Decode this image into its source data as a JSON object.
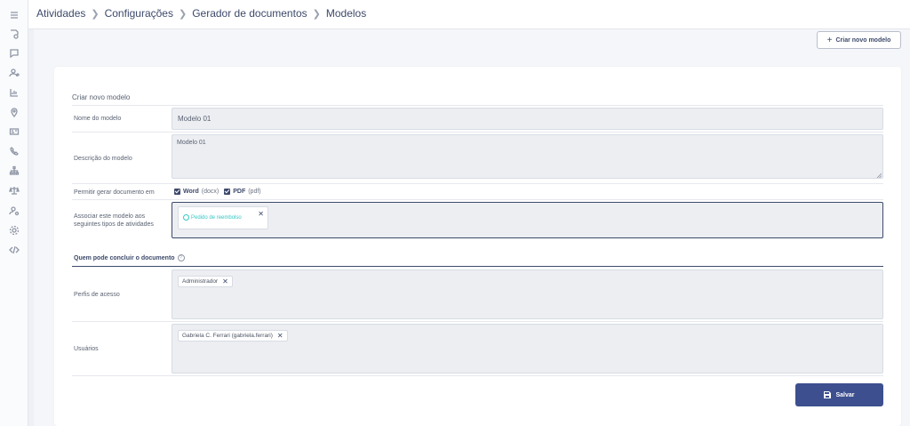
{
  "breadcrumb": [
    "Atividades",
    "Configurações",
    "Gerador de documentos",
    "Modelos"
  ],
  "toolbar": {
    "new_model_label": "Criar novo modelo"
  },
  "form": {
    "title": "Criar novo modelo",
    "name_label": "Nome do modelo",
    "name_value": "Modelo 01",
    "description_label": "Descrição do modelo",
    "description_value": "Modelo 01",
    "allow_label": "Permitir gerar documento em",
    "word_label": "Word",
    "word_ext": "(docx)",
    "pdf_label": "PDF",
    "pdf_ext": "(pdf)",
    "assoc_label_1": "Associar este modelo aos",
    "assoc_label_2": "seguintes tipos de atividades",
    "assoc_chip": "Pedido de reembolso",
    "section_title": "Quem pode concluir o documento",
    "profiles_label": "Perfis de acesso",
    "profiles_chip": "Administrador",
    "users_label": "Usuários",
    "users_chip": "Gabriela C. Ferrari (gabriela.ferrari)",
    "save_label": "Salvar"
  },
  "sidebar_icons": [
    "menu-icon",
    "activities-icon",
    "chat-icon",
    "contacts-icon",
    "chart-icon",
    "location-icon",
    "id-card-icon",
    "phone-icon",
    "org-chart-icon",
    "balance-icon",
    "user-settings-icon",
    "settings-icon",
    "code-icon"
  ],
  "colors": {
    "primary": "#3d4f8f",
    "accent": "#35c6c6",
    "text": "#3d4a6b"
  }
}
